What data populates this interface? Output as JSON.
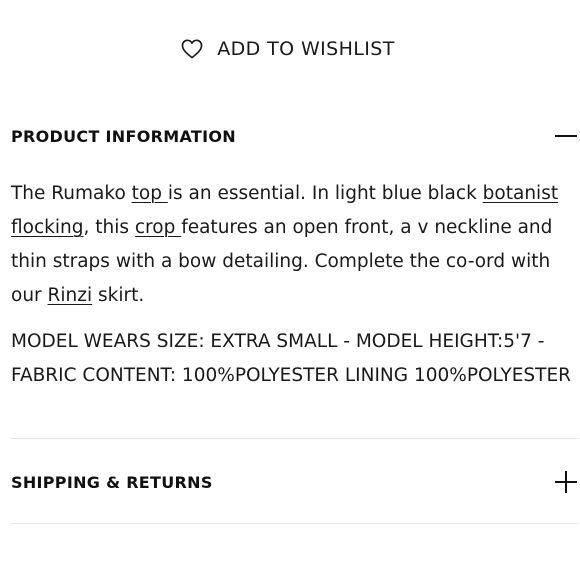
{
  "wishlist": {
    "label": "ADD TO WISHLIST",
    "icon": "heart-outline-icon"
  },
  "accordion": {
    "product_information": {
      "title": "PRODUCT INFORMATION",
      "state": "expanded",
      "toggle_icon": "minus-icon",
      "description": {
        "part1": "The Rumako ",
        "link_top": "top ",
        "part2": "is an essential. In light blue black ",
        "link_botanist": "botanist flocking",
        "part3": ", this ",
        "link_crop": "crop ",
        "part4": "features an open front, a v neckline and thin straps with a bow detailing. Complete the co-ord with our ",
        "link_rinzi": "Rinzi",
        "part5": " skirt."
      },
      "specs": "MODEL WEARS SIZE: EXTRA SMALL - MODEL HEIGHT:5'7 - FABRIC CONTENT: 100%POLYESTER LINING 100%POLYESTER"
    },
    "shipping_returns": {
      "title": "SHIPPING & RETURNS",
      "state": "collapsed",
      "toggle_icon": "plus-icon"
    }
  }
}
